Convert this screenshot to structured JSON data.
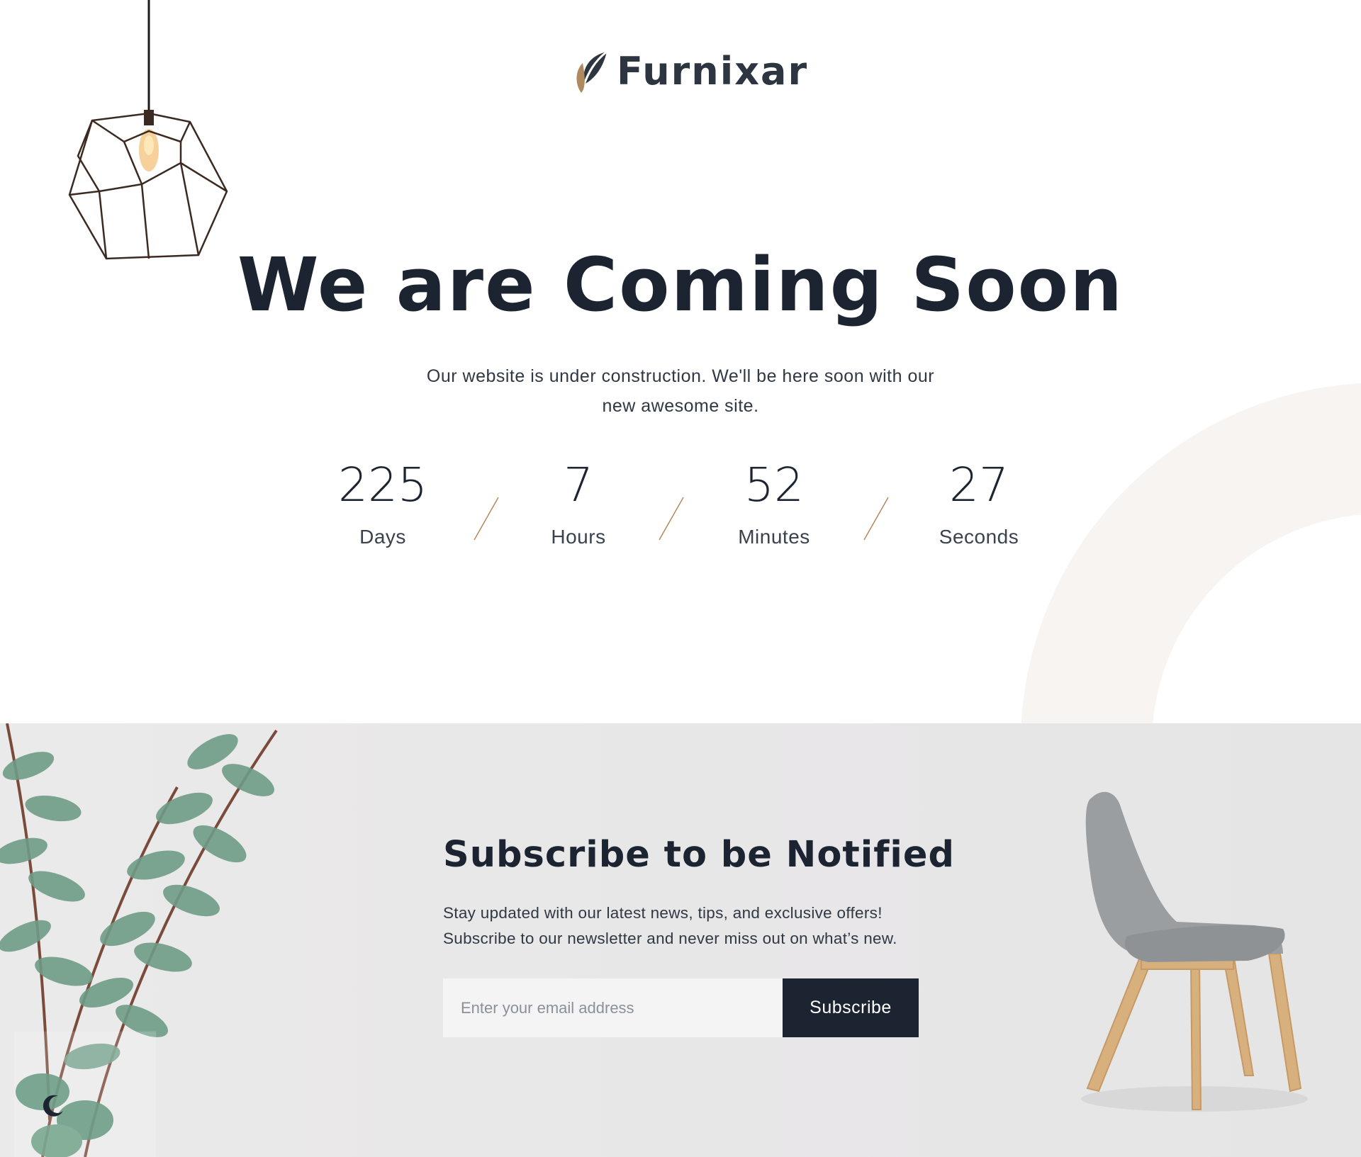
{
  "brand": {
    "name": "Furnixar",
    "logo_icon": "leaf-logo-icon",
    "accent_color": "#b08a5e"
  },
  "hero": {
    "title": "We are Coming Soon",
    "subtitle_line1": "Our website is under construction. We'll be here soon with our",
    "subtitle_line2": "new awesome site."
  },
  "countdown": [
    {
      "value": "225",
      "label": "Days"
    },
    {
      "value": "7",
      "label": "Hours"
    },
    {
      "value": "52",
      "label": "Minutes"
    },
    {
      "value": "27",
      "label": "Seconds"
    }
  ],
  "subscribe": {
    "title": "Subscribe to be Notified",
    "text_line1": "Stay updated with our latest news, tips, and exclusive offers!",
    "text_line2": "Subscribe to our newsletter and never miss out on what’s new.",
    "email_placeholder": "Enter your email address",
    "button_label": "Subscribe"
  },
  "colors": {
    "dark": "#1b2430",
    "accent": "#b08a5e",
    "section_bg": "#e9e8e8",
    "arc": "#f7f4f1"
  },
  "icons": {
    "theme_toggle": "moon-icon"
  }
}
